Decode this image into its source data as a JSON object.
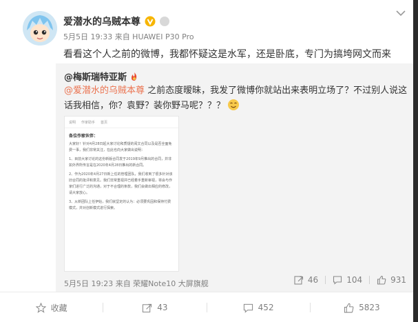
{
  "post": {
    "author": "爱潜水的乌贼本尊",
    "meta": "5月5日 19:33 来自 HUAWEI P30 Pro",
    "text": "看看这个人之前的微博，我都怀疑这是水军，还是卧底，专门为搞垮网文而来"
  },
  "repost": {
    "author": "@梅斯瑞特亚斯",
    "mention": "@爱潜水的乌贼本尊",
    "body": " 之前态度暧昧，我发了微博你就站出来表明立场了？不过别人说这话我相信，你？袁野？装你野马呢？？？",
    "image": {
      "tabs": [
        "说明",
        "作家助手",
        "首页"
      ],
      "title": "各位作家伙伴：",
      "paragraphs": [
        "大家好！针对4月28日起大家讨论和质疑的阅文合同以及是否全面免费一事，我们非常关注，在此也向大家做出说明：",
        "1、目前大家讨论的这份新版合同发于2019年9月推出的合同，并非如外界所传言是在2020年4月28日推出的新合同。",
        "2、作为2020年4月27日新上任的管理团队，我们收到了很多针对该旧合同的批评和意见。我们非常重视并已经着手重新审视，将会与作家们进行广泛的沟通，对于不合理的条款，我们会做出相应的修改，请大家放心。",
        "3、从新团队上任伊始，我们就坚定的认为：必须要巩固和保持付费模式，并对创新模式进行探索。"
      ]
    },
    "meta": "5月5日 19:23 来自 荣耀Note10 大屏旗舰",
    "forwards": "46",
    "comments": "104",
    "likes": "931"
  },
  "actions": {
    "favorite": "收藏",
    "forward": "43",
    "comment": "452",
    "like": "5823"
  },
  "icons": {
    "verified": "verified-v-icon",
    "medal": "medal-icon",
    "menu": "chevron-down-icon",
    "repost_author": "fire-emoji-icon",
    "emoji": "smiling-face-emoji-icon",
    "star": "star-icon",
    "forward": "forward-icon",
    "comment": "comment-icon",
    "like": "thumbs-up-icon"
  },
  "colors": {
    "mention": "#eb7350",
    "verified": "#f7b500"
  }
}
